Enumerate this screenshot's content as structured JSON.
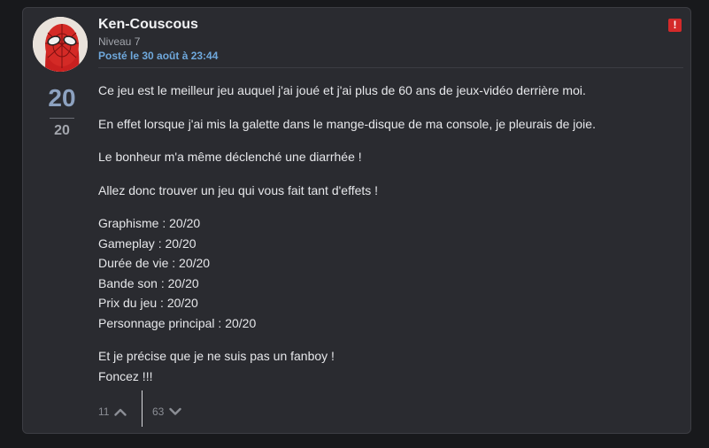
{
  "post": {
    "author": "Ken-Couscous",
    "level": "Niveau 7",
    "posted": "Posté le 30 août à 23:44",
    "report_icon": "!",
    "score": "20",
    "score_sub": "20",
    "paragraphs": [
      "Ce jeu est le meilleur jeu auquel j'ai joué et j'ai plus de 60 ans de jeux-vidéo derrière moi.",
      "En effet lorsque j'ai mis la galette dans le mange-disque de ma console, je pleurais de joie.",
      "Le bonheur m'a même déclenché une diarrhée !",
      "Allez donc trouver un jeu qui vous fait tant d'effets !"
    ],
    "ratings": [
      "Graphisme : 20/20",
      "Gameplay : 20/20",
      "Durée de vie : 20/20",
      "Bande son : 20/20",
      "Prix du jeu : 20/20",
      "Personnage principal : 20/20"
    ],
    "closing": [
      "Et je précise que je ne suis pas un fanboy !",
      "Foncez !!!"
    ],
    "upvotes": "11",
    "downvotes": "63"
  },
  "icons": {
    "report": "exclamation-icon",
    "upvote": "chevron-up-icon",
    "downvote": "chevron-down-icon",
    "avatar": "spiderman-avatar"
  },
  "colors": {
    "background": "#18191c",
    "card": "#2a2b30",
    "accent": "#6fa8dc",
    "score": "#8da2c0",
    "report": "#d42a2a"
  }
}
